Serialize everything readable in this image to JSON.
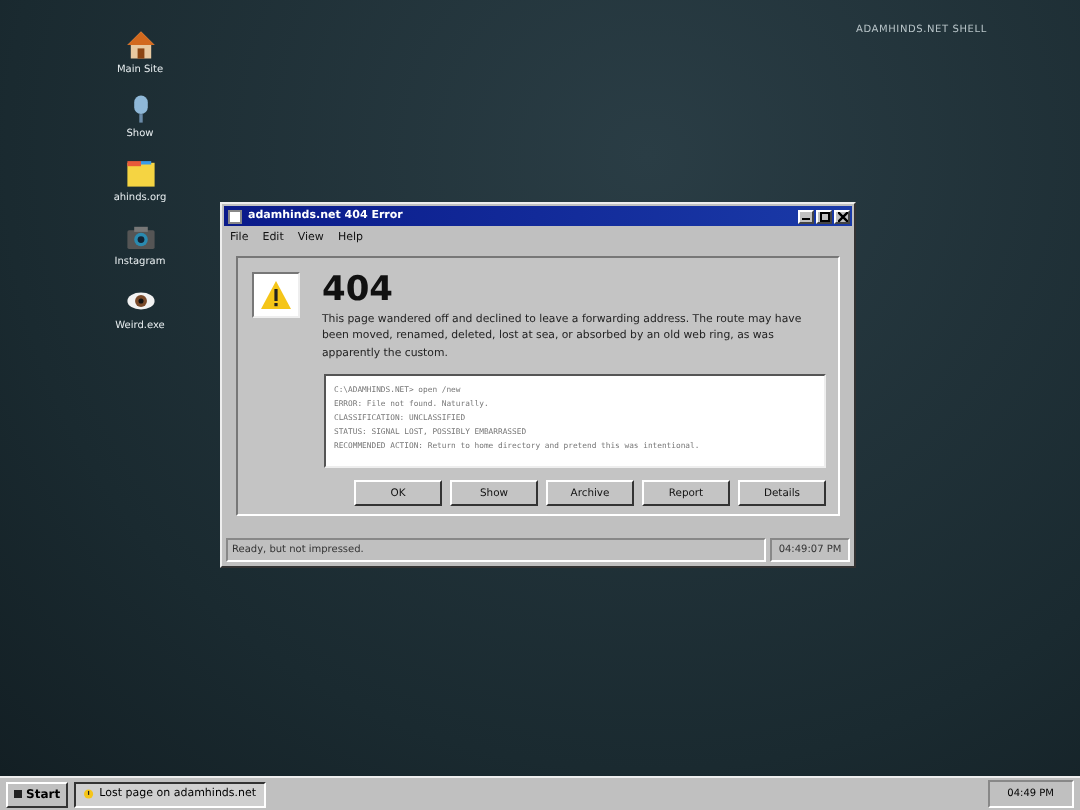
{
  "desktop_label": "ADAMHINDS.NET SHELL",
  "desktop_icons": [
    {
      "label": "Main Site"
    },
    {
      "label": "Show"
    },
    {
      "label": "ahinds.org"
    },
    {
      "label": "Instagram"
    },
    {
      "label": "Weird.exe"
    }
  ],
  "window": {
    "title": "adamhinds.net 404 Error",
    "menu": [
      "File",
      "Edit",
      "View",
      "Help"
    ],
    "heading": "404",
    "message": "This page wandered off and declined to leave a forwarding address. The route may have been moved, renamed, deleted, lost at sea, or absorbed by an old web ring, as was apparently the custom.",
    "console": [
      "C:\\ADAMHINDS.NET> open /new",
      "ERROR: File not found. Naturally.",
      "CLASSIFICATION: UNCLASSIFIED",
      "STATUS: SIGNAL LOST, POSSIBLY EMBARRASSED",
      "RECOMMENDED ACTION: Return to home directory and pretend this was intentional."
    ],
    "buttons": [
      "OK",
      "Show",
      "Archive",
      "Report",
      "Details"
    ],
    "status": "Ready, but not impressed.",
    "status_time": "04:49:07 PM"
  },
  "taskbar": {
    "start": "Start",
    "task": "Lost page on adamhinds.net",
    "clock": "04:49 PM"
  }
}
